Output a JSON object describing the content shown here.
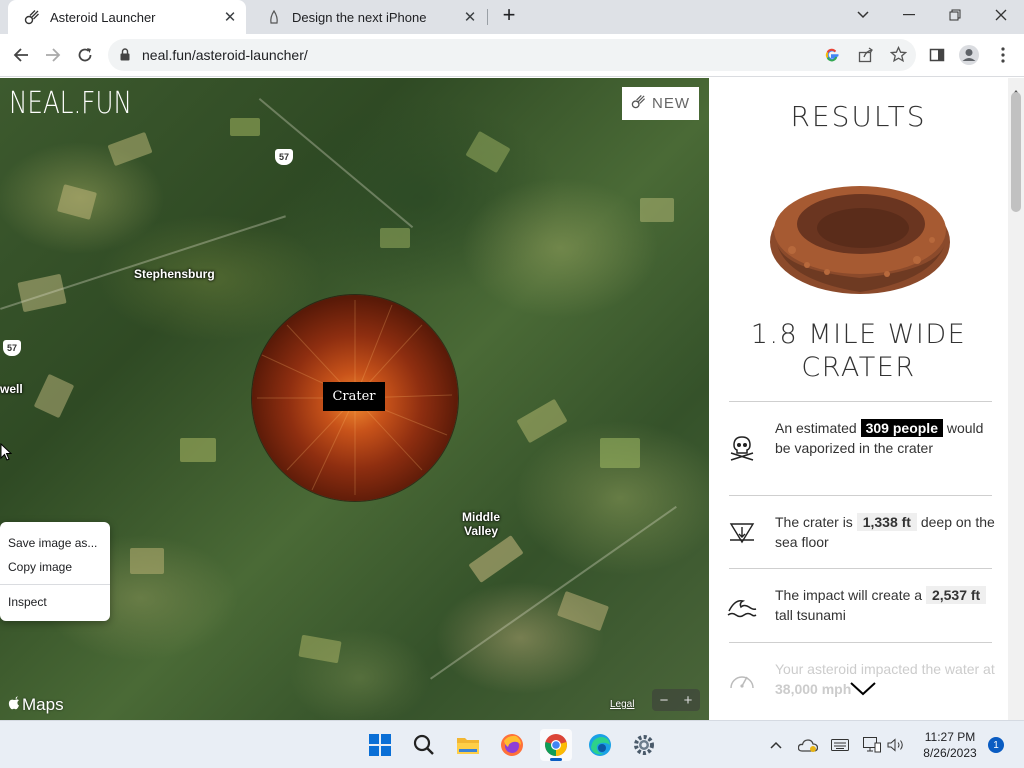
{
  "browser": {
    "tabs": [
      {
        "title": "Asteroid Launcher",
        "active": true
      },
      {
        "title": "Design the next iPhone",
        "active": false
      }
    ],
    "url": "neal.fun/asteroid-launcher/"
  },
  "map": {
    "logo": "NEAL.FUN",
    "new_label": "NEW",
    "places": [
      "Stephensburg",
      "Middle Valley",
      "well"
    ],
    "route_shields": [
      "57",
      "57"
    ],
    "crater_label": "Crater",
    "maps_brand": "Maps",
    "legal": "Legal",
    "zoom_out": "−",
    "zoom_in": "+"
  },
  "context_menu": {
    "items": [
      "Save image as...",
      "Copy image",
      "Inspect"
    ]
  },
  "results": {
    "title": "RESULTS",
    "crater_heading_line1": "1.8 MILE WIDE",
    "crater_heading_line2": "CRATER",
    "stats": [
      {
        "icon": "skull-icon",
        "pre": "An estimated",
        "value": "309 people",
        "post": "would be vaporized in the crater"
      },
      {
        "icon": "depth-icon",
        "pre": "The crater is",
        "value": "1,338 ft",
        "post": "deep on the sea floor"
      },
      {
        "icon": "wave-icon",
        "pre": "The impact will create a",
        "value": "2,537 ft",
        "post": "tall tsunami"
      },
      {
        "icon": "speedometer-icon",
        "pre": "Your asteroid impacted the water at",
        "value": "38,000 mph",
        "post": ""
      }
    ]
  },
  "taskbar": {
    "time": "11:27 PM",
    "date": "8/26/2023",
    "notification_count": "1"
  },
  "colors": {
    "crater_core": "#f08a30",
    "crater_edge": "#2a0c05",
    "highlight_dark": "#000000",
    "taskbar_bg": "#e9eef5"
  }
}
